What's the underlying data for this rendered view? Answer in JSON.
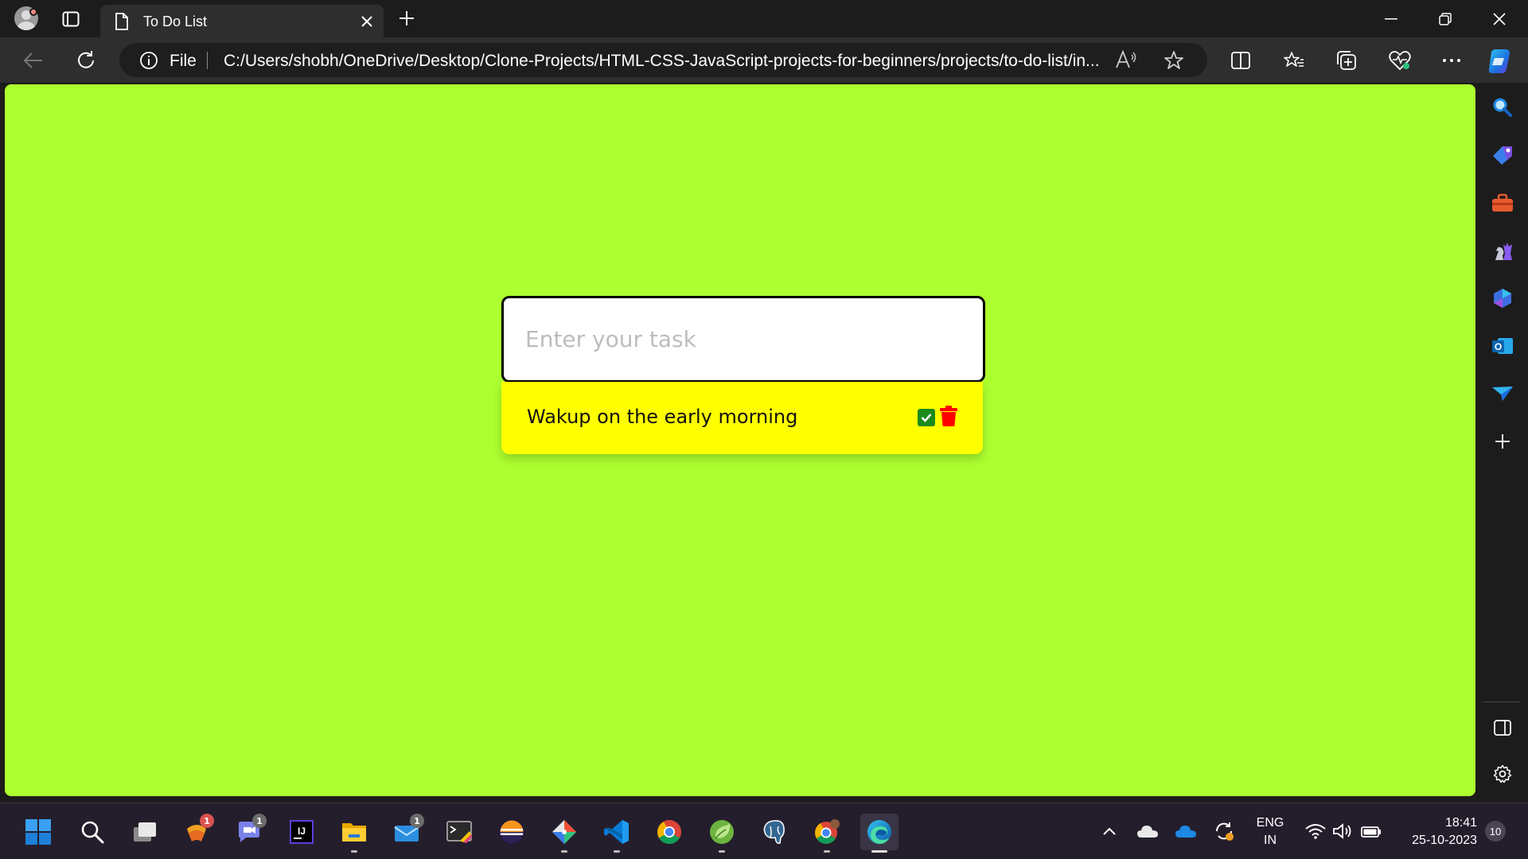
{
  "browser": {
    "tab": {
      "title": "To Do List"
    },
    "address": {
      "scheme": "File",
      "url": "C:/Users/shobh/OneDrive/Desktop/Clone-Projects/HTML-CSS-JavaScript-projects-for-beginners/projects/to-do-list/in..."
    },
    "read_aloud_label": "A̅",
    "sidebar_icons": [
      "search-icon",
      "tag-icon",
      "toolbox-icon",
      "chess-icon",
      "copilot-icon",
      "outlook-icon",
      "paper-plane-icon",
      "plus-icon",
      "split-pane-icon",
      "settings-icon"
    ]
  },
  "page": {
    "background_color": "#adff2f",
    "input": {
      "placeholder": "Enter your task",
      "value": ""
    },
    "tasks": [
      {
        "text": "Wakup on the early morning",
        "done": false
      }
    ],
    "accent": {
      "list_bg": "#ffff00",
      "check": "#1b8a1b",
      "delete": "#ff0000"
    }
  },
  "taskbar": {
    "apps": [
      {
        "name": "start",
        "badge": ""
      },
      {
        "name": "search",
        "badge": ""
      },
      {
        "name": "task-view",
        "badge": ""
      },
      {
        "name": "widgets",
        "badge": "1"
      },
      {
        "name": "teams-chat",
        "badge": "1"
      },
      {
        "name": "intellij",
        "badge": ""
      },
      {
        "name": "file-explorer",
        "badge": ""
      },
      {
        "name": "mail",
        "badge": "1"
      },
      {
        "name": "snipping-tool",
        "badge": ""
      },
      {
        "name": "eclipse",
        "badge": ""
      },
      {
        "name": "git",
        "badge": ""
      },
      {
        "name": "vscode",
        "badge": ""
      },
      {
        "name": "chrome",
        "badge": ""
      },
      {
        "name": "spring-tools",
        "badge": ""
      },
      {
        "name": "postgresql",
        "badge": ""
      },
      {
        "name": "chrome-profile",
        "badge": ""
      },
      {
        "name": "edge",
        "badge": ""
      }
    ],
    "language": {
      "line1": "ENG",
      "line2": "IN"
    },
    "clock": {
      "time": "18:41",
      "date": "25-10-2023"
    },
    "notifications": "10"
  }
}
